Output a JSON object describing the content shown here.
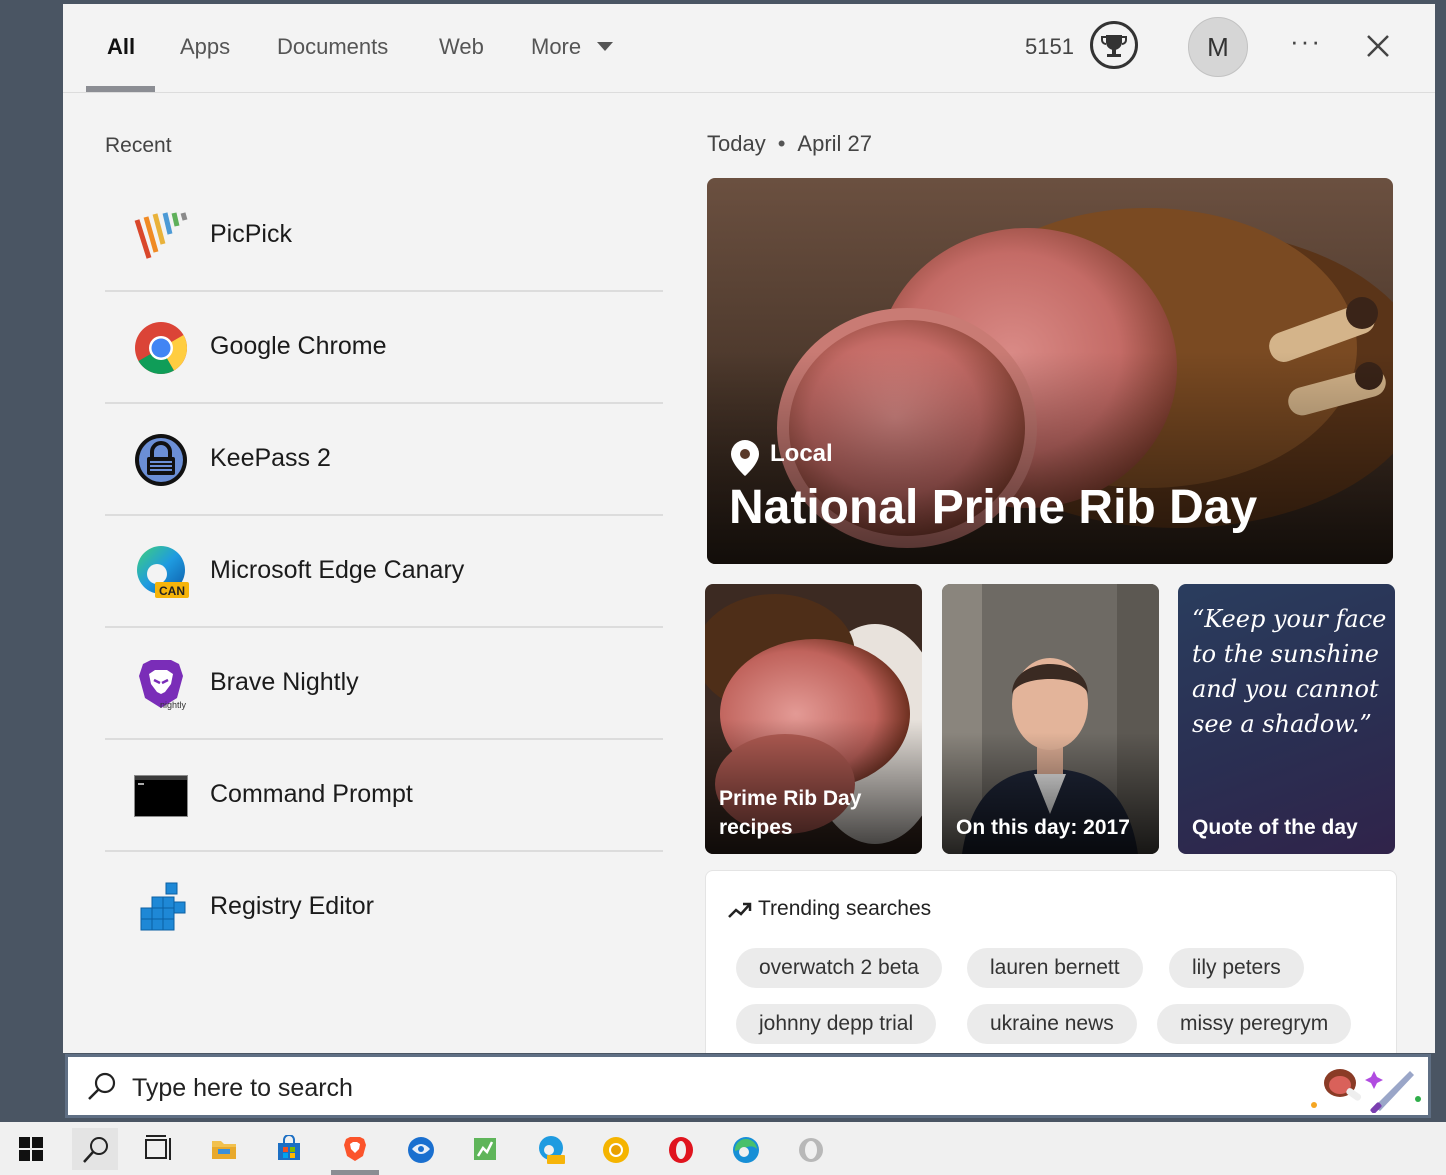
{
  "tabs": [
    {
      "label": "All",
      "active": true
    },
    {
      "label": "Apps"
    },
    {
      "label": "Documents"
    },
    {
      "label": "Web"
    },
    {
      "label": "More"
    }
  ],
  "header": {
    "points": "5151",
    "avatar_initial": "M",
    "trophy_icon": "trophy-icon",
    "more_options_icon": "ellipsis-icon",
    "close_icon": "close-icon"
  },
  "recent": {
    "heading": "Recent",
    "items": [
      {
        "label": "PicPick",
        "icon": "picpick-icon"
      },
      {
        "label": "Google Chrome",
        "icon": "chrome-icon"
      },
      {
        "label": "KeePass 2",
        "icon": "keepass-icon"
      },
      {
        "label": "Microsoft Edge Canary",
        "icon": "edge-canary-icon"
      },
      {
        "label": "Brave Nightly",
        "icon": "brave-nightly-icon"
      },
      {
        "label": "Command Prompt",
        "icon": "command-prompt-icon"
      },
      {
        "label": "Registry Editor",
        "icon": "registry-editor-icon"
      }
    ]
  },
  "today": {
    "label": "Today",
    "date": "April 27"
  },
  "hero": {
    "tag": "Local",
    "title": "National Prime Rib Day"
  },
  "cards": [
    {
      "label": "Prime Rib Day recipes"
    },
    {
      "label": "On this day: 2017"
    },
    {
      "label": "Quote of the day",
      "quote": "“Keep your face to the sunshine and you cannot see a shadow.”"
    }
  ],
  "trending": {
    "title": "Trending searches",
    "items": [
      "overwatch 2 beta",
      "lauren bernett",
      "lily peters",
      "johnny depp trial",
      "ukraine news",
      "missy peregrym"
    ]
  },
  "search": {
    "placeholder": "Type here to search"
  },
  "colors": {
    "panel_bg": "#f3f3f3",
    "desktop_bg": "#4a5563",
    "taskbar_bg": "#f0f0f0",
    "pill_bg": "#ebebeb",
    "accent_underline": "#8b8d93"
  }
}
